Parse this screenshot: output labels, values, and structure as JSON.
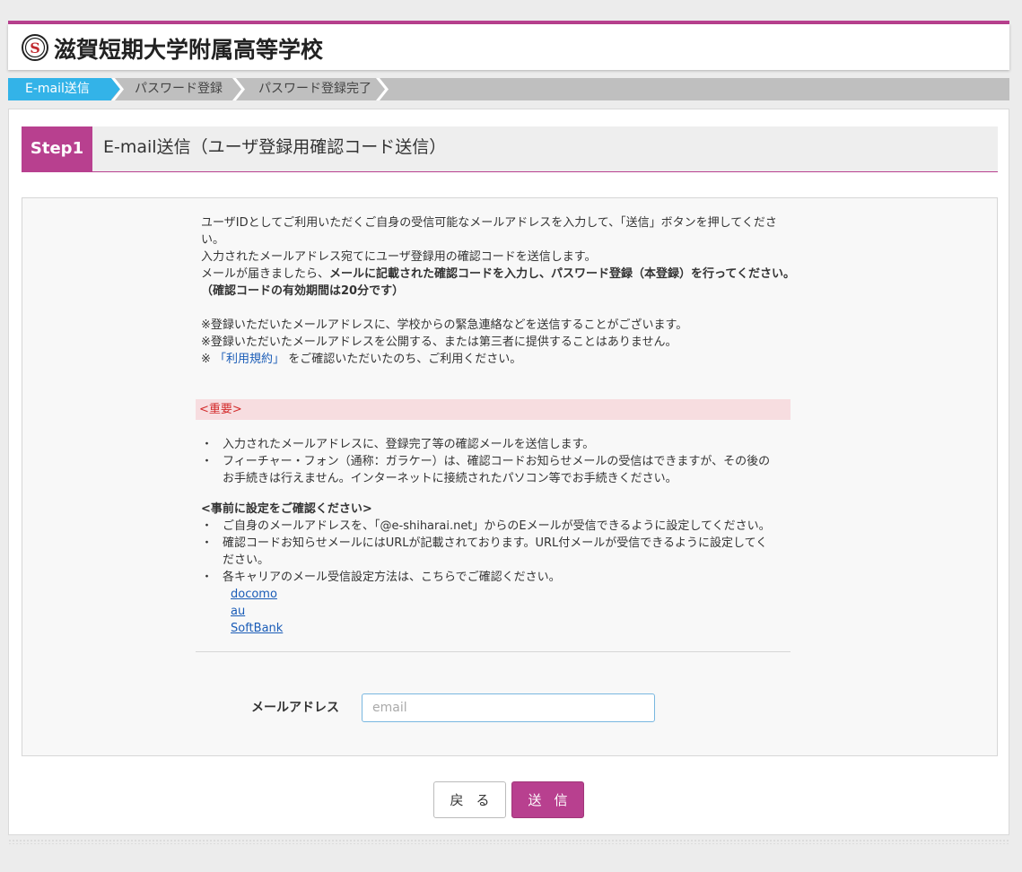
{
  "header": {
    "school_name": "滋賀短期大学附属高等学校",
    "logo_letter": "S",
    "accent_color": "#b8408f"
  },
  "steps": [
    {
      "label": "E-mail送信",
      "active": true
    },
    {
      "label": "パスワード登録",
      "active": false
    },
    {
      "label": "パスワード登録完了",
      "active": false
    }
  ],
  "step_heading": {
    "badge": "Step1",
    "title": "E-mail送信（ユーザ登録用確認コード送信）"
  },
  "intro": {
    "line1": "ユーザIDとしてご利用いただくご自身の受信可能なメールアドレスを入力して、「送信」ボタンを押してくださ",
    "line2": "い。",
    "line3": "入力されたメールアドレス宛てにユーザ登録用の確認コードを送信します。",
    "line4_pre": "メールが届きましたら、",
    "line4_bold": "メールに記載された確認コードを入力し、パスワード登録（本登録）を行ってください。",
    "line5_bold": "（確認コードの有効期間は20分です）"
  },
  "notes": {
    "note1": "※登録いただいたメールアドレスに、学校からの緊急連絡などを送信することがございます。",
    "note2": "※登録いただいたメールアドレスを公開する、または第三者に提供することはありません。",
    "note3_pre": "※",
    "note3_link": "「利用規約」",
    "note3_post": "をご確認いただいたのち、ご利用ください。"
  },
  "important": {
    "label": "<重要>",
    "bullet1": "入力されたメールアドレスに、登録完了等の確認メールを送信します。",
    "bullet2_line1": "フィーチャー・フォン（通称：ガラケー）は、確認コードお知らせメールの受信はできますが、その後の",
    "bullet2_line2": "お手続きは行えません。インターネットに接続されたパソコン等でお手続きください。"
  },
  "presettings": {
    "heading": "<事前に設定をご確認ください>",
    "bullet1": "ご自身のメールアドレスを、「@e-shiharai.net」からのEメールが受信できるように設定してください。",
    "bullet2_line1": "確認コードお知らせメールにはURLが記載されております。URL付メールが受信できるように設定してく",
    "bullet2_line2": "ださい。",
    "bullet3": "各キャリアのメール受信設定方法は、こちらでご確認ください。",
    "carriers": [
      "docomo",
      "au",
      "SoftBank"
    ]
  },
  "form": {
    "email_label": "メールアドレス",
    "email_placeholder": "email",
    "email_value": ""
  },
  "buttons": {
    "back": "戻る",
    "send": "送信"
  }
}
